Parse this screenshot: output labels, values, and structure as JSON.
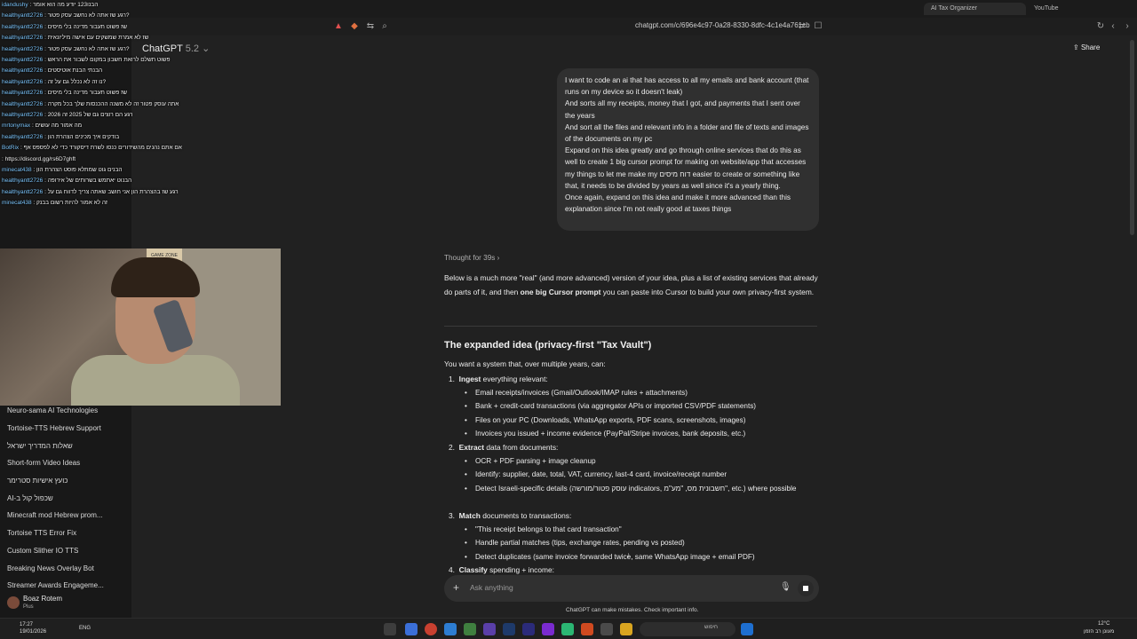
{
  "browser": {
    "tabs": [
      "AI Tax Organizer",
      "YouTube"
    ],
    "url": "chatgpt.com/c/696e4c97-0a28-8330-8dfc-4c1e4a761cb"
  },
  "header": {
    "model": "ChatGPT",
    "version": "5.2",
    "share": "Share"
  },
  "sidebar": {
    "items": [
      "Neuro-sama AI Technologies",
      "Tortoise-TTS Hebrew Support",
      "שאלות המדריך ישראל",
      "Short-form Video Ideas",
      "כועץ אישיות סטרימר",
      "AI-שכפול קול ב",
      "Minecraft mod Hebrew prom...",
      "Tortoise TTS Error Fix",
      "Custom Slither IO TTS",
      "Breaking News Overlay Bot",
      "Streamer Awards Engageme..."
    ],
    "user_name": "Boaz Rotem",
    "user_plan": "Plus"
  },
  "chat_overlay": [
    {
      "name": "idandushy",
      "msg": "הבנו123 יודע מה הוא אומר"
    },
    {
      "name": "healthyantt2726",
      "msg": "רגע שז אתה לא נחשב עסק פטור?"
    },
    {
      "name": "healthyantt2726",
      "msg": "שז פשוט תעבור מדינה בלי מיסים"
    },
    {
      "name": "healthyantt2726",
      "msg": "שז לא אמרת שמשקים עם אישה מיליונאית"
    },
    {
      "name": "healthyantt2726",
      "msg": "רגע שז אתה לא נחשב עסק פטור?"
    },
    {
      "name": "healthyantt2726",
      "msg": "פשוט תשלם לרואת חשבון במקום לשבור את הראש"
    },
    {
      "name": "healthyantt2726",
      "msg": "הבנתי הבנת אוטיסטים"
    },
    {
      "name": "healthyantt2726",
      "msg": "נו זה לא נכלל גם על זה?"
    },
    {
      "name": "healthyantt2726",
      "msg": "שז פשוט תעבור מדינה בלי מיסים"
    },
    {
      "name": "healthyantt2726",
      "msg": "אתה עוסק פטור זה לא משנה ההכנסות שלך בכל מקרה"
    },
    {
      "name": "healthyantt2726",
      "msg": "רגע הם רוצים גם של 2025 זה 2026"
    },
    {
      "name": "mrtonymax",
      "msg": "מה אמור מה עושים"
    },
    {
      "name": "healthyantt2726",
      "msg": "בודקים איך מכינים הצהרת הון"
    },
    {
      "name": "BotRix",
      "msg": "אם אתם נהנים מהשידורים כנסו לשרת דיסקורד כדי לא לפספס אף"
    },
    {
      "name": "",
      "msg": "https://discord.gg/rs6D7ghft"
    },
    {
      "name": "minecat438",
      "msg": "הבנים גוט שמתלא פוסט הצהרת הון"
    },
    {
      "name": "healthyantt2726",
      "msg": "הבנוט יאתמש בשרותים של אירופה"
    },
    {
      "name": "healthyantt2726",
      "msg": "רגע שז בהצהרת הון אני חושב שאתה צריך לדווח גם על"
    },
    {
      "name": "minecat438",
      "msg": "זה לא אמור להיות רשום בבנק"
    }
  ],
  "user_message": [
    "I want to code an ai that has access to all my emails and bank account (that runs on my device so it doesn't leak)",
    "And sorts all my receipts, money that I got, and payments that I sent over the years",
    "And sort all the files and relevant info in a folder and file of texts and images of the documents on my pc",
    "Expand on this idea greatly and go through online services that do this as well to create 1 big cursor prompt for making on website/app that accesses my things to let me make my דוח מיסים easier to create or something like that, it needs to be divided by years as well since it's a yearly thing.",
    "Once again, expand on this idea and make it more advanced than this explanation since I'm not really good at taxes things"
  ],
  "assistant": {
    "thought": "Thought for 39s",
    "intro_a": "Below is a much more \"real\" (and more advanced) version of your idea, plus a list of existing services that already do parts of it, and then",
    "intro_bold": "one big Cursor prompt",
    "intro_b": "you can paste into Cursor to build your own privacy-first system.",
    "heading": "The expanded idea (privacy-first \"Tax Vault\")",
    "lead": "You want a system that, over multiple years, can:",
    "sections": [
      {
        "num": "1.",
        "bold": "Ingest",
        "rest": "everything relevant:"
      },
      {
        "num": "2.",
        "bold": "Extract",
        "rest": "data from documents:"
      },
      {
        "num": "3.",
        "bold": "Match",
        "rest": "documents to transactions:"
      },
      {
        "num": "4.",
        "bold": "Classify",
        "rest": "spending + income:"
      }
    ],
    "bullets": [
      "Email receipts/invoices (Gmail/Outlook/IMAP rules + attachments)",
      "Bank + credit-card transactions (via aggregator APIs or imported CSV/PDF statements)",
      "Files on your PC (Downloads, WhatsApp exports, PDF scans, screenshots, images)",
      "Invoices you issued + income evidence (PayPal/Stripe invoices, bank deposits, etc.)",
      "OCR + PDF parsing + image cleanup",
      "Identify: supplier, date, total, VAT, currency, last-4 card, invoice/receipt number",
      "Detect Israeli-specific details (עוסק פטור/מורשה indicators, חשבונית מס, \"מע\"מ\", etc.) where possible",
      "\"This receipt belongs to that card transaction\"",
      "Handle partial matches (tips, exchange rates, pending vs posted)",
      "Detect duplicates (same invoice forwarded twice, same WhatsApp image + email PDF)"
    ]
  },
  "composer": {
    "placeholder": "Ask anything",
    "disclaimer": "ChatGPT can make mistakes. Check important info."
  },
  "taskbar": {
    "time": "17:27",
    "date": "19/01/2026",
    "lang": "ENG",
    "search": "חיפוש",
    "weather_temp": "12°C",
    "weather_desc": "מעונן רב הזמן"
  }
}
